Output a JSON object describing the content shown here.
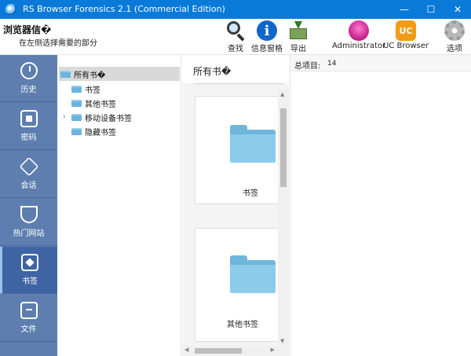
{
  "window": {
    "title": "RS Browser Forensics 2.1 (Commercial Edition)",
    "min": "—",
    "max": "☐",
    "close": "✕"
  },
  "toolbar": {
    "title": "浏览器信�",
    "subtitle": "在左侧选择需要的部分",
    "buttons": [
      {
        "label": "查找",
        "icon": "search-icon"
      },
      {
        "label": "信息窗格",
        "icon": "info-icon"
      },
      {
        "label": "导出",
        "icon": "export-icon"
      },
      {
        "label": "Administrator",
        "icon": "admin-profile-icon"
      },
      {
        "label": "UC Browser",
        "icon": "uc-browser-icon"
      },
      {
        "label": "选项",
        "icon": "gear-icon"
      }
    ],
    "info_glyph": "i",
    "uc_glyph": "UC"
  },
  "sidebar": {
    "items": [
      {
        "label": "历史",
        "icon": "history-icon"
      },
      {
        "label": "密码",
        "icon": "password-icon"
      },
      {
        "label": "会话",
        "icon": "session-icon"
      },
      {
        "label": "热门网站",
        "icon": "trophy-icon"
      },
      {
        "label": "书签",
        "icon": "bookmark-icon",
        "active": true
      },
      {
        "label": "文件",
        "icon": "file-icon"
      }
    ]
  },
  "tree": {
    "items": [
      {
        "label": "所有书�",
        "selected": true
      },
      {
        "label": "书签"
      },
      {
        "label": "其他书签"
      },
      {
        "label": "移动设备书签",
        "expandable": true,
        "caret": "›"
      },
      {
        "label": "隐藏书签"
      }
    ]
  },
  "middle": {
    "title": "所有书�",
    "cards": [
      {
        "label": "书签"
      },
      {
        "label": "其他书签"
      }
    ]
  },
  "right": {
    "total_label": "总项目:",
    "total_value": "14"
  },
  "colors": {
    "titlebar": "#0a7ad8",
    "sidebar": "#5d7eaf",
    "sidebar_active": "#3e64a3",
    "folder": "#6eb6db"
  }
}
